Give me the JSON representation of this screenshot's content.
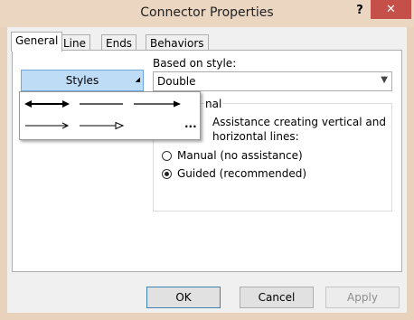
{
  "window": {
    "title": "Connector Properties",
    "help": "?",
    "close": "✕"
  },
  "tabs": [
    "General",
    "Line",
    "Ends",
    "Behaviors"
  ],
  "general": {
    "based_on_label": "Based on style:",
    "based_on_value": "Double",
    "group_partial_label": "nal",
    "assist_line1": "Assistance creating vertical and",
    "assist_line2": "horizontal lines:",
    "radio_manual": "Manual (no assistance)",
    "radio_guided": "Guided (recommended)",
    "selected_radio": "guided"
  },
  "styles": {
    "label": "Styles",
    "more": "..."
  },
  "buttons": {
    "ok": "OK",
    "cancel": "Cancel",
    "apply": "Apply"
  }
}
